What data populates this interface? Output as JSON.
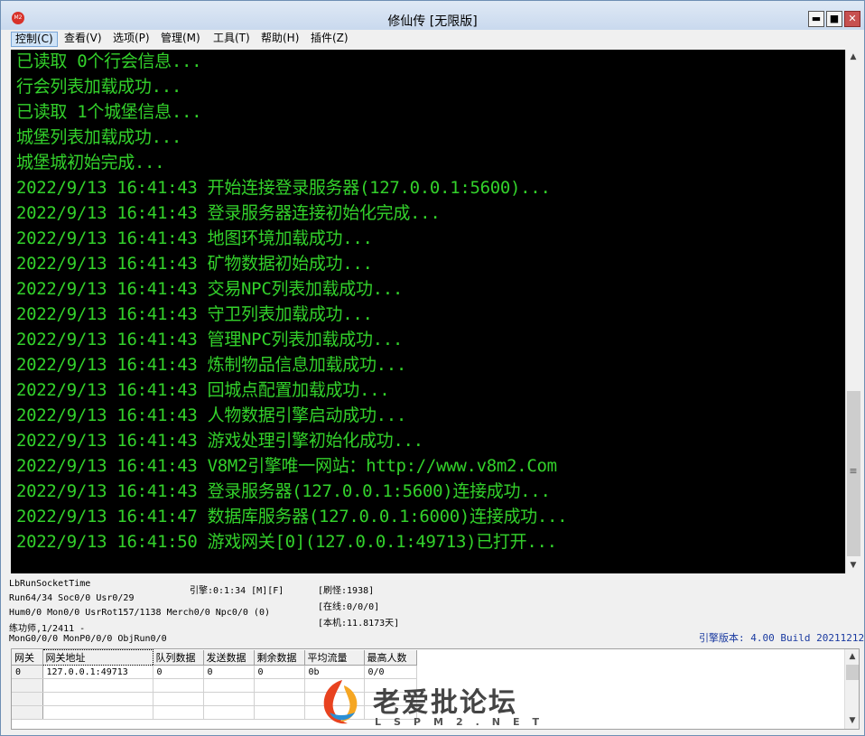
{
  "window": {
    "title": "修仙传 [无限版]",
    "min_glyph": "▬",
    "max_glyph": "■",
    "close_glyph": "✕"
  },
  "menu": [
    {
      "label": "控制(C)"
    },
    {
      "label": "查看(V)"
    },
    {
      "label": "选项(P)"
    },
    {
      "label": "管理(M)"
    },
    {
      "label": "工具(T)"
    },
    {
      "label": "帮助(H)"
    },
    {
      "label": "插件(Z)"
    }
  ],
  "console": {
    "text_color": "#33d12b",
    "lines": [
      "已读取 0个行会信息...",
      "行会列表加载成功...",
      "已读取 1个城堡信息...",
      "城堡列表加载成功...",
      "城堡城初始完成...",
      "2022/9/13 16:41:43 开始连接登录服务器(127.0.0.1:5600)...",
      "2022/9/13 16:41:43 登录服务器连接初始化完成...",
      "2022/9/13 16:41:43 地图环境加载成功...",
      "2022/9/13 16:41:43 矿物数据初始成功...",
      "2022/9/13 16:41:43 交易NPC列表加载成功...",
      "2022/9/13 16:41:43 守卫列表加载成功...",
      "2022/9/13 16:41:43 管理NPC列表加载成功...",
      "2022/9/13 16:41:43 炼制物品信息加载成功...",
      "2022/9/13 16:41:43 回城点配置加载成功...",
      "2022/9/13 16:41:43 人物数据引擎启动成功...",
      "2022/9/13 16:41:43 游戏处理引擎初始化成功...",
      "2022/9/13 16:41:43 V8M2引擎唯一网站：http://www.v8m2.Com",
      "2022/9/13 16:41:43 登录服务器(127.0.0.1:5600)连接成功...",
      "2022/9/13 16:41:47 数据库服务器(127.0.0.1:6000)连接成功...",
      "2022/9/13 16:41:50 游戏网关[0](127.0.0.1:49713)已打开..."
    ]
  },
  "status": {
    "col1": [
      "LbRunSocketTime",
      "Run64/34 Soc0/0 Usr0/29",
      "Hum0/0 Mon0/0 UsrRot157/1138 Merch0/0 Npc0/0 (0)",
      "练功师,1/2411 -",
      "MonG0/0/0 MonP0/0/0 ObjRun0/0"
    ],
    "engine_time": "引擎:0:1:34 [M][F]",
    "refresh": "[刷怪:1938]",
    "online": "[在线:0/0/0]",
    "machine": "[本机:11.8173天]",
    "version": "引擎版本: 4.00 Build 20211212"
  },
  "gateway_table": {
    "headers": [
      "网关",
      "网关地址",
      "队列数据",
      "发送数据",
      "剩余数据",
      "平均流量",
      "最高人数"
    ],
    "rows": [
      [
        "0",
        "127.0.0.1:49713",
        "0",
        "0",
        "0",
        "0b",
        "0/0"
      ],
      [
        "",
        "",
        "",
        "",
        "",
        "",
        ""
      ],
      [
        "",
        "",
        "",
        "",
        "",
        "",
        ""
      ],
      [
        "",
        "",
        "",
        "",
        "",
        "",
        ""
      ]
    ]
  },
  "scroll": {
    "up_glyph": "▲",
    "down_glyph": "▼",
    "grip_glyph": "≡"
  },
  "watermark": {
    "text": "老爱批论坛",
    "sub": "LSPM2.NET"
  }
}
